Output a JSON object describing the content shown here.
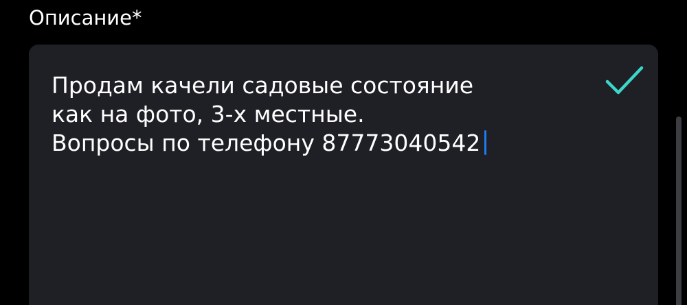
{
  "field": {
    "label": "Описание*",
    "value_lines": [
      "Продам качели садовые состояние",
      "как на фото, 3-х местные.",
      "Вопросы по телефону 87773040542"
    ]
  },
  "icons": {
    "valid": "check-icon"
  },
  "colors": {
    "background": "#000000",
    "field_background": "#1f2026",
    "text": "#ffffff",
    "check": "#3dd6c8",
    "caret": "#1e7cf2"
  }
}
